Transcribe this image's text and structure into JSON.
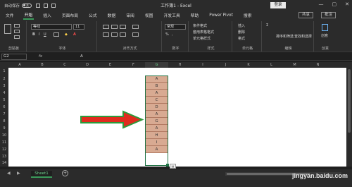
{
  "titlebar": {
    "autosave_label": "自动保存",
    "autosave_state": "关",
    "title": "工作簿1 - Excel",
    "login_label": "登录",
    "window_controls": [
      "—",
      "▢",
      "✕"
    ]
  },
  "tabs": {
    "items": [
      "文件",
      "开始",
      "插入",
      "页面布局",
      "公式",
      "数据",
      "审阅",
      "视图",
      "开发工具",
      "帮助",
      "Power Pivot",
      "搜索"
    ],
    "active": "开始",
    "share_label": "共享",
    "comment_label": "批注"
  },
  "ribbon": {
    "font_name": "等线",
    "font_size": "11",
    "number_format": "常规",
    "conditional_format": "条件格式",
    "table_format": "套用表格格式",
    "cell_styles": "单元格样式",
    "insert": "插入",
    "delete": "删除",
    "format": "格式",
    "sort_filter": "排序和筛选",
    "find_select": "查找和选择",
    "ideas": "创意",
    "groups": [
      "剪贴板",
      "字体",
      "对齐方式",
      "数字",
      "样式",
      "单元格",
      "编辑",
      "创意"
    ]
  },
  "formula_bar": {
    "name_box": "G2",
    "fx": "fx",
    "value": "A"
  },
  "sheet": {
    "columns": [
      "A",
      "B",
      "C",
      "D",
      "E",
      "F",
      "G",
      "H",
      "I",
      "J",
      "K",
      "L",
      "M",
      "N"
    ],
    "rows": [
      "1",
      "2",
      "3",
      "4",
      "5",
      "6",
      "7",
      "8",
      "9",
      "10",
      "11",
      "12",
      "13",
      "14"
    ],
    "column_g_values": [
      "A",
      "B",
      "A",
      "C",
      "D",
      "A",
      "G",
      "A",
      "H",
      "I",
      "A"
    ],
    "selection_color": "#1f7244",
    "cell_fill": "#d8aa92",
    "arrow_fill": "#e02b1e",
    "arrow_outline": "#2c9a3a"
  },
  "bottom": {
    "sheet_tab": "Sheet1",
    "add_sheet": "+"
  },
  "watermark": "jingyan.baidu.com"
}
